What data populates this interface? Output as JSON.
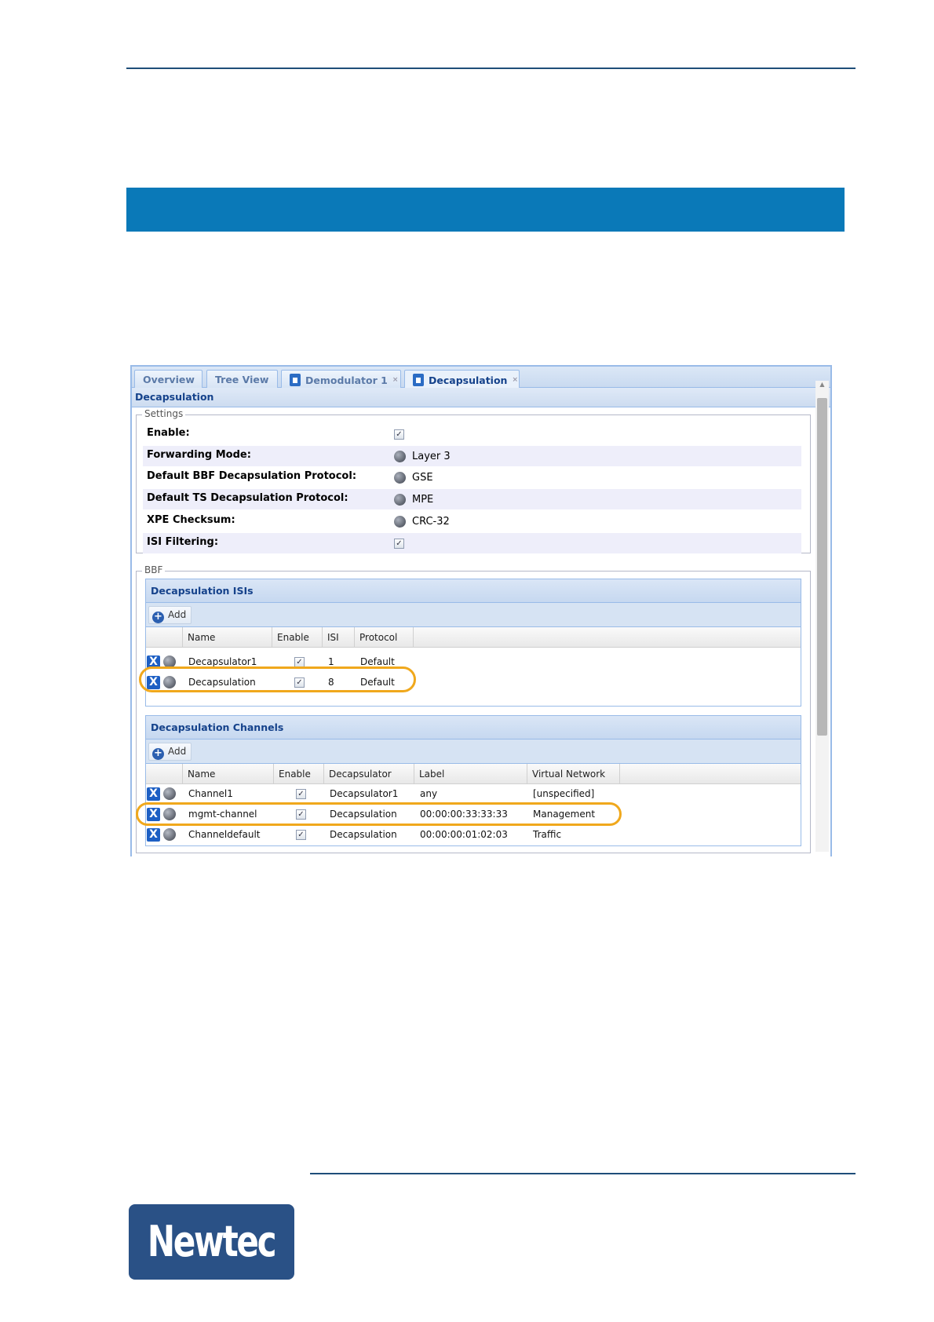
{
  "brand": {
    "logo_text": "Newtec",
    "bar_color": "#0a79b8",
    "logo_color": "#2a5186",
    "highlight_color": "#f0a81c"
  },
  "tabs": [
    {
      "label": "Overview"
    },
    {
      "label": "Tree View"
    },
    {
      "label": "Demodulator 1",
      "closable": true
    },
    {
      "label": "Decapsulation",
      "closable": true,
      "active": true
    }
  ],
  "close_glyph": "×",
  "title": "Decapsulation",
  "settings": {
    "legend": "Settings",
    "rows": [
      {
        "label": "Enable:",
        "type": "checkbox",
        "checked": true,
        "value": "✓"
      },
      {
        "label": "Forwarding Mode:",
        "type": "select",
        "value": "Layer 3"
      },
      {
        "label": "Default BBF Decapsulation Protocol:",
        "type": "select",
        "value": "GSE"
      },
      {
        "label": "Default TS Decapsulation Protocol:",
        "type": "select",
        "value": "MPE"
      },
      {
        "label": "XPE Checksum:",
        "type": "select",
        "value": "CRC-32"
      },
      {
        "label": "ISI Filtering:",
        "type": "checkbox",
        "checked": true,
        "value": "✓"
      }
    ]
  },
  "bbf": {
    "legend": "BBF",
    "isis": {
      "title": "Decapsulation ISIs",
      "add_label": "Add",
      "columns": [
        "Name",
        "Enable",
        "ISI",
        "Protocol"
      ],
      "rows": [
        {
          "name": "Decapsulator1",
          "enable": "✓",
          "isi": "1",
          "protocol": "Default"
        },
        {
          "name": "Decapsulation",
          "enable": "✓",
          "isi": "8",
          "protocol": "Default",
          "highlighted": true
        }
      ]
    },
    "channels": {
      "title": "Decapsulation Channels",
      "add_label": "Add",
      "columns": [
        "Name",
        "Enable",
        "Decapsulator",
        "Label",
        "Virtual Network"
      ],
      "rows": [
        {
          "name": "Channel1",
          "enable": "✓",
          "decapsulator": "Decapsulator1",
          "label": "any",
          "vn": "[unspecified]"
        },
        {
          "name": "mgmt-channel",
          "enable": "✓",
          "decapsulator": "Decapsulation",
          "label": "00:00:00:33:33:33",
          "vn": "Management",
          "highlighted": true
        },
        {
          "name": "Channeldefault",
          "enable": "✓",
          "decapsulator": "Decapsulation",
          "label": "00:00:00:01:02:03",
          "vn": "Traffic"
        }
      ]
    }
  },
  "icons": {
    "delete": "X",
    "add": "+"
  }
}
